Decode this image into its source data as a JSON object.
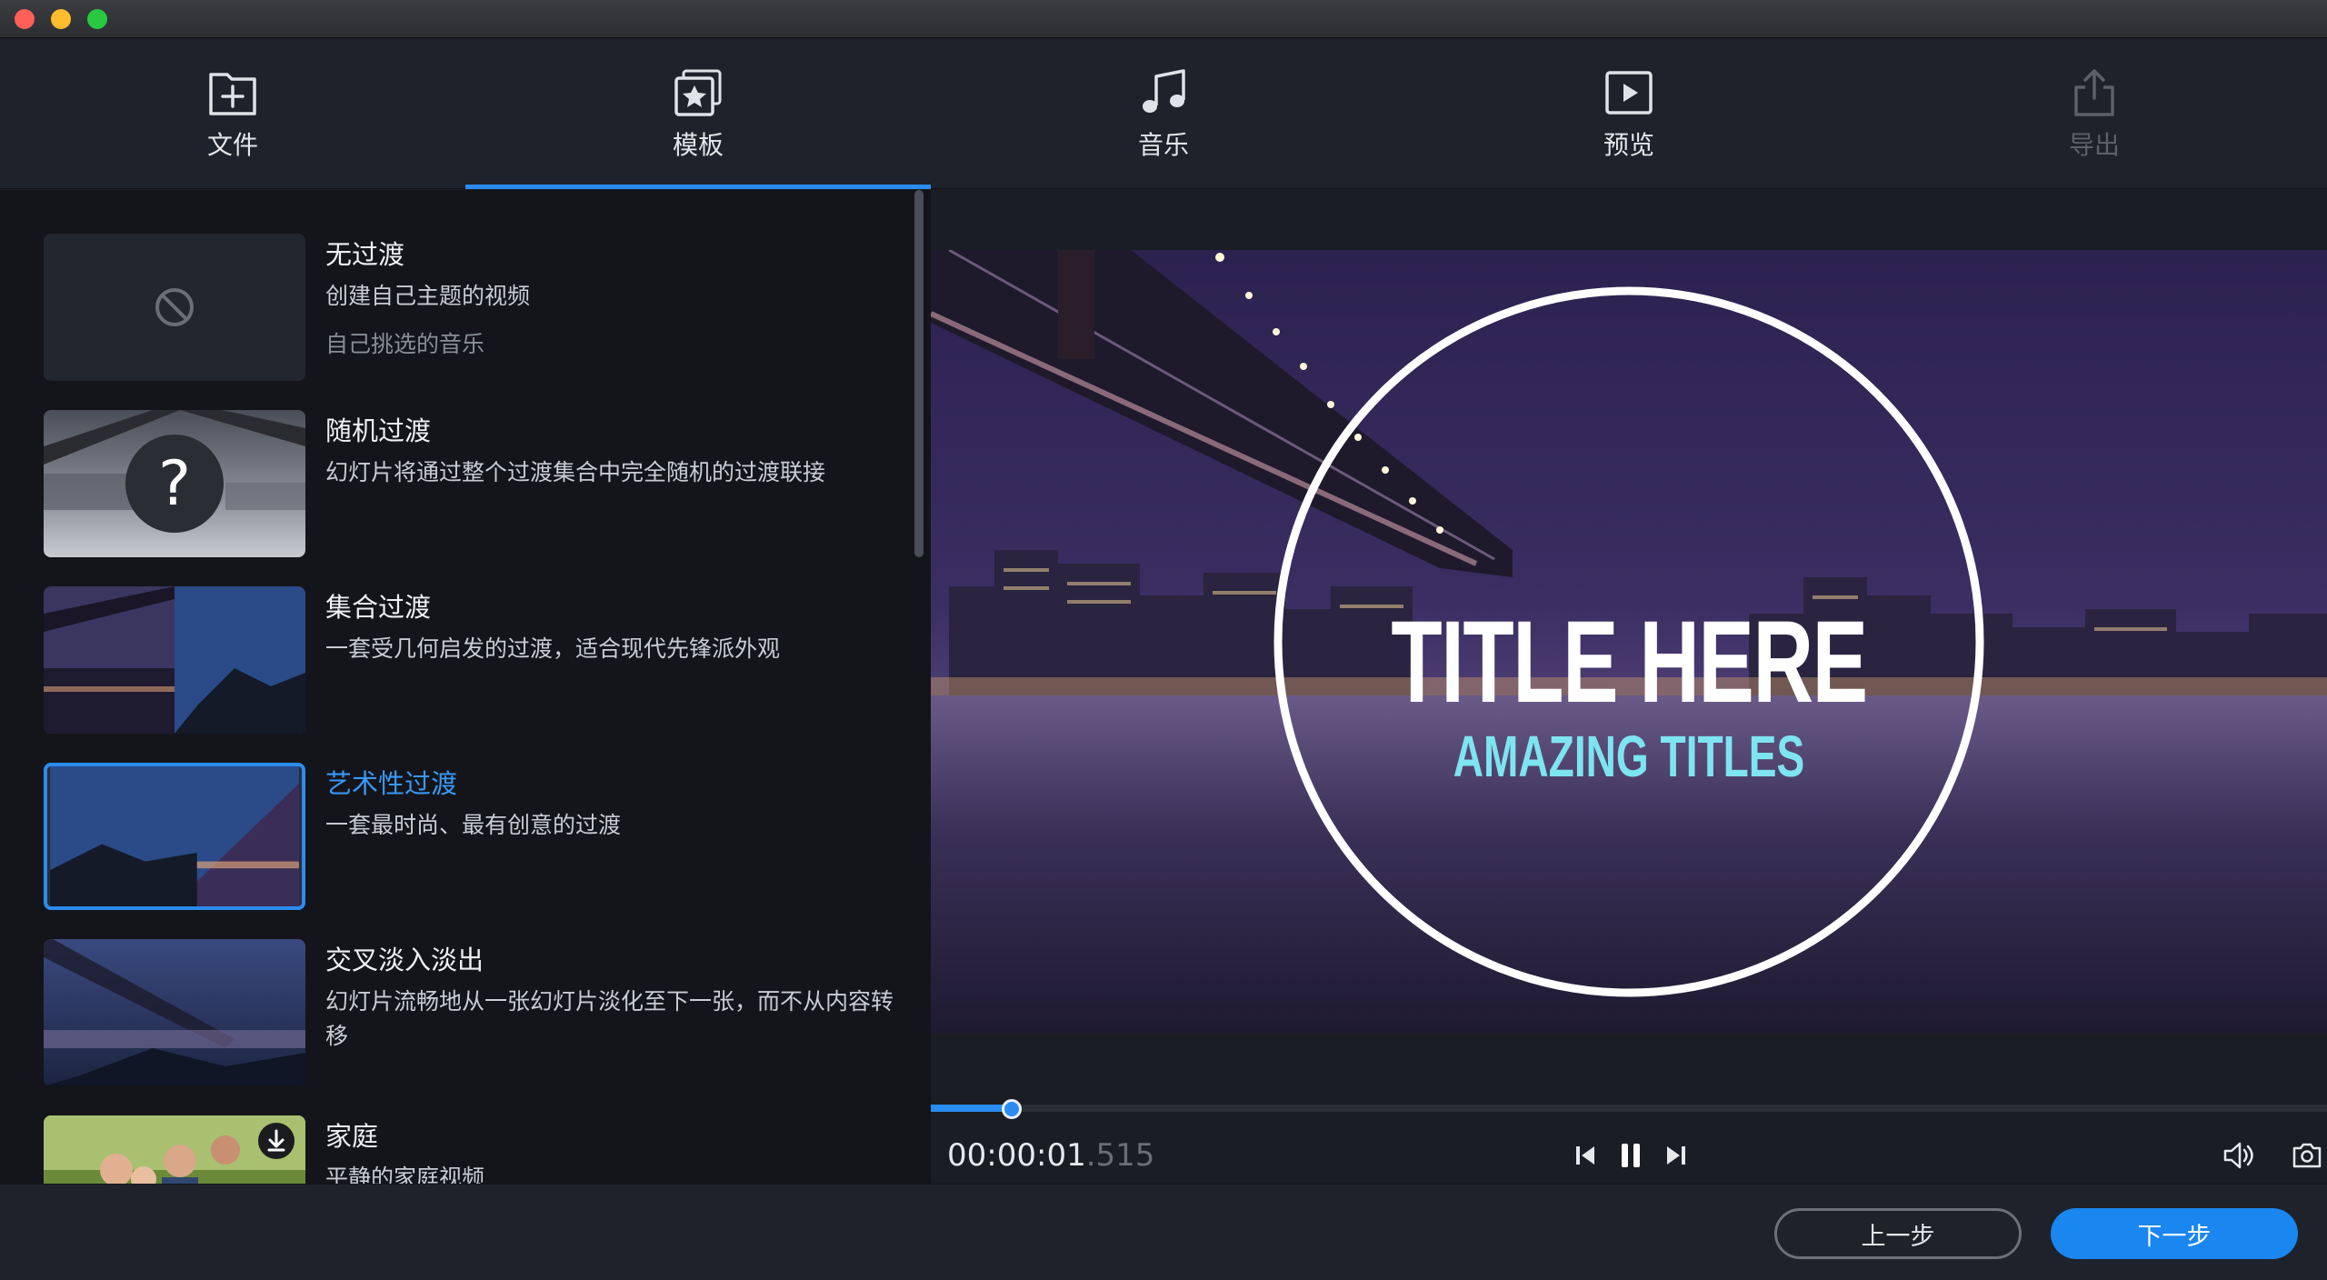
{
  "toolbar": {
    "tabs": [
      {
        "label": "文件",
        "icon": "file-add-icon"
      },
      {
        "label": "模板",
        "icon": "template-star-icon",
        "active": true
      },
      {
        "label": "音乐",
        "icon": "music-note-icon"
      },
      {
        "label": "预览",
        "icon": "play-preview-icon"
      },
      {
        "label": "导出",
        "icon": "export-icon",
        "disabled": true
      }
    ]
  },
  "templates": [
    {
      "title": "无过渡",
      "desc": "创建自己主题的视频",
      "sub": "自己挑选的音乐",
      "thumb": "none-icon"
    },
    {
      "title": "随机过渡",
      "desc": "幻灯片将通过整个过渡集合中完全随机的过渡联接",
      "thumb": "question-icon"
    },
    {
      "title": "集合过渡",
      "desc": "一套受几何启发的过渡，适合现代先锋派外观"
    },
    {
      "title": "艺术性过渡",
      "desc": "一套最时尚、最有创意的过渡",
      "selected": true
    },
    {
      "title": "交叉淡入淡出",
      "desc": "幻灯片流畅地从一张幻灯片淡化至下一张，而不从内容转移"
    },
    {
      "title": "家庭",
      "desc": "平静的家庭视频",
      "download": "download-icon"
    }
  ],
  "preview": {
    "title_text": "TITLE HERE",
    "subtitle_text": "AMAZING TITLES",
    "progress": 0.058,
    "time_main": "00:00:01",
    "time_ms": ".515"
  },
  "controls": {
    "prev_frame": "step-back-icon",
    "pause": "pause-icon",
    "next_frame": "step-forward-icon",
    "volume": "volume-icon",
    "snapshot": "camera-icon"
  },
  "footer": {
    "prev_label": "上一步",
    "next_label": "下一步"
  },
  "colors": {
    "accent": "#2a8cf0",
    "subtitle": "#7ee4ef"
  }
}
